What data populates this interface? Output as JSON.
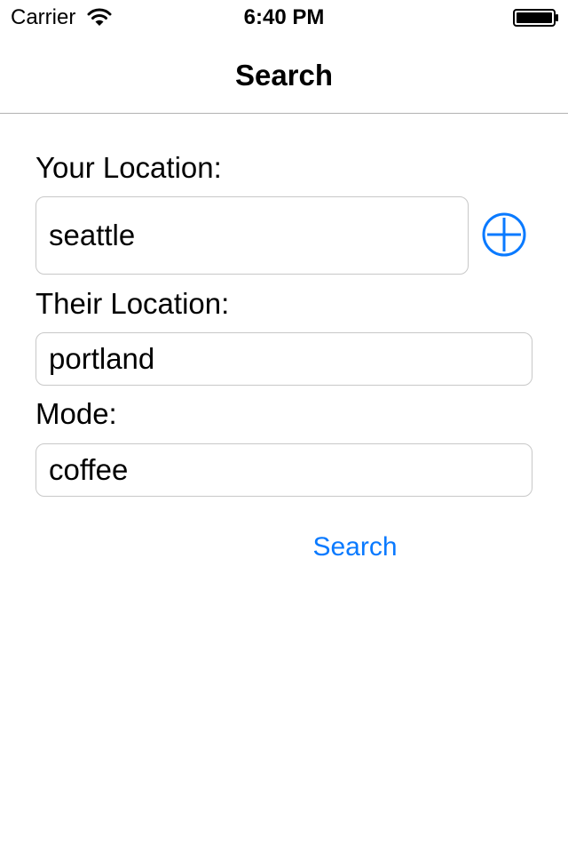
{
  "status_bar": {
    "carrier": "Carrier",
    "time": "6:40 PM",
    "wifi_icon": "wifi-icon",
    "battery_icon": "battery-icon"
  },
  "nav": {
    "title": "Search"
  },
  "form": {
    "your_location": {
      "label": "Your Location:",
      "value": "seattle"
    },
    "add_location_icon": "plus-circle-icon",
    "their_location": {
      "label": "Their Location:",
      "value": "portland"
    },
    "mode": {
      "label": "Mode:",
      "value": "coffee"
    },
    "search_button": "Search"
  },
  "colors": {
    "accent": "#0a7aff",
    "field_border": "#c8c8c8",
    "separator": "#b2b2b2"
  }
}
